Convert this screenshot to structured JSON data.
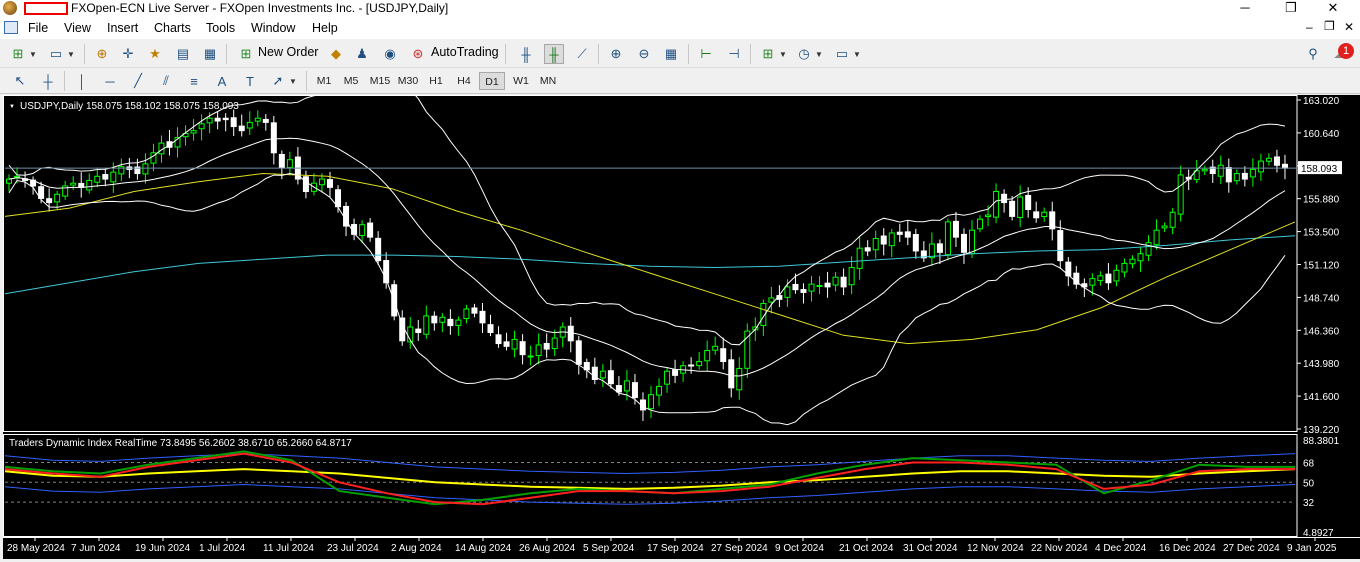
{
  "window": {
    "title": "FXOpen-ECN Live Server - FXOpen Investments Inc. - [USDJPY,Daily]",
    "minimize": "─",
    "maximize": "❐",
    "close": "✕"
  },
  "menu": {
    "items": [
      "File",
      "View",
      "Insert",
      "Charts",
      "Tools",
      "Window",
      "Help"
    ],
    "notification_count": "1"
  },
  "toolbar": {
    "new_order": "New Order",
    "autotrading": "AutoTrading"
  },
  "timeframes": [
    "M1",
    "M5",
    "M15",
    "M30",
    "H1",
    "H4",
    "D1",
    "W1",
    "MN"
  ],
  "active_timeframe": "D1",
  "colors": {
    "background": "#000000",
    "bull": "#00ff00",
    "bear": "#ffffff",
    "bollinger": "#ffffff",
    "ma_yellow": "#e0e020",
    "ma_cyan": "#40c8d8",
    "tdi_red": "#ff2020",
    "tdi_green": "#00a000",
    "tdi_yellow": "#ffff00",
    "tdi_blue": "#3060ff"
  },
  "main_chart": {
    "header": "USDJPY,Daily  158.075 158.102 158.075 158.093",
    "current_price": "158.093",
    "price_labels": [
      "163.020",
      "160.640",
      "158.260",
      "155.880",
      "153.500",
      "151.120",
      "148.740",
      "146.360",
      "143.980",
      "141.600",
      "139.220"
    ]
  },
  "indicator": {
    "header": "Traders Dynamic Index RealTime 73.8495 56.2602 38.6710 65.2660 64.8717",
    "labels": [
      "88.3801",
      "68",
      "50",
      "32",
      "4.8927"
    ]
  },
  "date_labels": [
    "28 May 2024",
    "7 Jun 2024",
    "19 Jun 2024",
    "1 Jul 2024",
    "11 Jul 2024",
    "23 Jul 2024",
    "2 Aug 2024",
    "14 Aug 2024",
    "26 Aug 2024",
    "5 Sep 2024",
    "17 Sep 2024",
    "27 Sep 2024",
    "9 Oct 2024",
    "21 Oct 2024",
    "31 Oct 2024",
    "12 Nov 2024",
    "22 Nov 2024",
    "4 Dec 2024",
    "16 Dec 2024",
    "27 Dec 2024",
    "9 Jan 2025"
  ],
  "chart_data": {
    "type": "candlestick",
    "symbol": "USDJPY",
    "timeframe": "Daily",
    "ylim": [
      139.22,
      163.02
    ],
    "closes": [
      157.3,
      157.5,
      157.2,
      156.8,
      155.9,
      155.6,
      156.2,
      156.8,
      157.0,
      156.7,
      157.2,
      157.5,
      157.3,
      157.8,
      158.2,
      158.0,
      157.7,
      158.4,
      159.2,
      159.9,
      159.6,
      160.3,
      160.6,
      160.8,
      161.3,
      161.7,
      161.5,
      161.6,
      161.1,
      160.8,
      161.4,
      161.7,
      161.4,
      159.2,
      158.1,
      158.7,
      157.3,
      156.4,
      157.0,
      157.3,
      156.7,
      155.3,
      153.9,
      153.3,
      154.0,
      153.1,
      151.4,
      149.8,
      147.4,
      145.6,
      146.6,
      146.2,
      147.4,
      146.9,
      147.3,
      146.7,
      147.1,
      147.9,
      147.6,
      146.9,
      146.2,
      145.4,
      145.2,
      145.7,
      144.6,
      144.5,
      145.3,
      145.0,
      145.8,
      146.6,
      145.6,
      143.9,
      143.5,
      142.8,
      143.4,
      142.5,
      141.9,
      142.7,
      141.5,
      140.6,
      141.7,
      142.3,
      143.4,
      143.1,
      143.8,
      143.8,
      144.1,
      144.9,
      145.2,
      144.1,
      142.2,
      143.6,
      146.3,
      146.6,
      148.3,
      148.7,
      148.6,
      149.5,
      149.3,
      149.1,
      149.7,
      149.6,
      149.5,
      150.2,
      149.5,
      150.9,
      152.3,
      152.1,
      153.0,
      152.6,
      153.4,
      153.3,
      153.1,
      152.1,
      151.6,
      152.6,
      152.0,
      154.2,
      153.1,
      152.0,
      153.6,
      154.4,
      154.7,
      156.4,
      155.6,
      154.6,
      156.0,
      155.1,
      154.5,
      154.9,
      153.7,
      151.4,
      150.3,
      149.7,
      149.5,
      150.1,
      150.3,
      149.8,
      150.7,
      151.2,
      151.5,
      151.9,
      152.7,
      153.6,
      153.9,
      154.9,
      157.6,
      157.3,
      157.9,
      158.0,
      157.7,
      158.3,
      157.1,
      157.7,
      157.3,
      158.0,
      158.6,
      158.8,
      158.3,
      158.09
    ],
    "ma_yellow": [
      154.6,
      155.2,
      156.4,
      157.1,
      157.7,
      157.5,
      156.6,
      155.0,
      153.6,
      152.0,
      150.5,
      149.0,
      147.5,
      146.0,
      145.4,
      145.7,
      146.4,
      148.0,
      150.2,
      152.2,
      154.2
    ],
    "ma_cyan": [
      149.0,
      149.8,
      150.6,
      151.2,
      151.5,
      151.8,
      151.8,
      151.7,
      151.5,
      151.2,
      151.0,
      150.9,
      151.0,
      151.3,
      151.6,
      151.9,
      152.1,
      152.2,
      152.5,
      152.9,
      153.2
    ],
    "tdi_rsi": [
      64,
      60,
      58,
      66,
      72,
      78,
      70,
      42,
      36,
      30,
      34,
      40,
      44,
      42,
      40,
      44,
      48,
      58,
      66,
      72,
      70,
      68,
      66,
      40,
      52,
      66,
      64,
      64
    ],
    "tdi_signal": [
      62,
      58,
      55,
      64,
      70,
      76,
      68,
      50,
      40,
      32,
      30,
      36,
      42,
      42,
      40,
      42,
      46,
      54,
      62,
      68,
      68,
      66,
      62,
      44,
      48,
      60,
      62,
      62
    ],
    "tdi_baseline": [
      60,
      56,
      55,
      58,
      60,
      62,
      60,
      58,
      54,
      50,
      48,
      46,
      45,
      44,
      45,
      47,
      50,
      52,
      55,
      58,
      60,
      60,
      58,
      56,
      55,
      58,
      60,
      62
    ]
  }
}
